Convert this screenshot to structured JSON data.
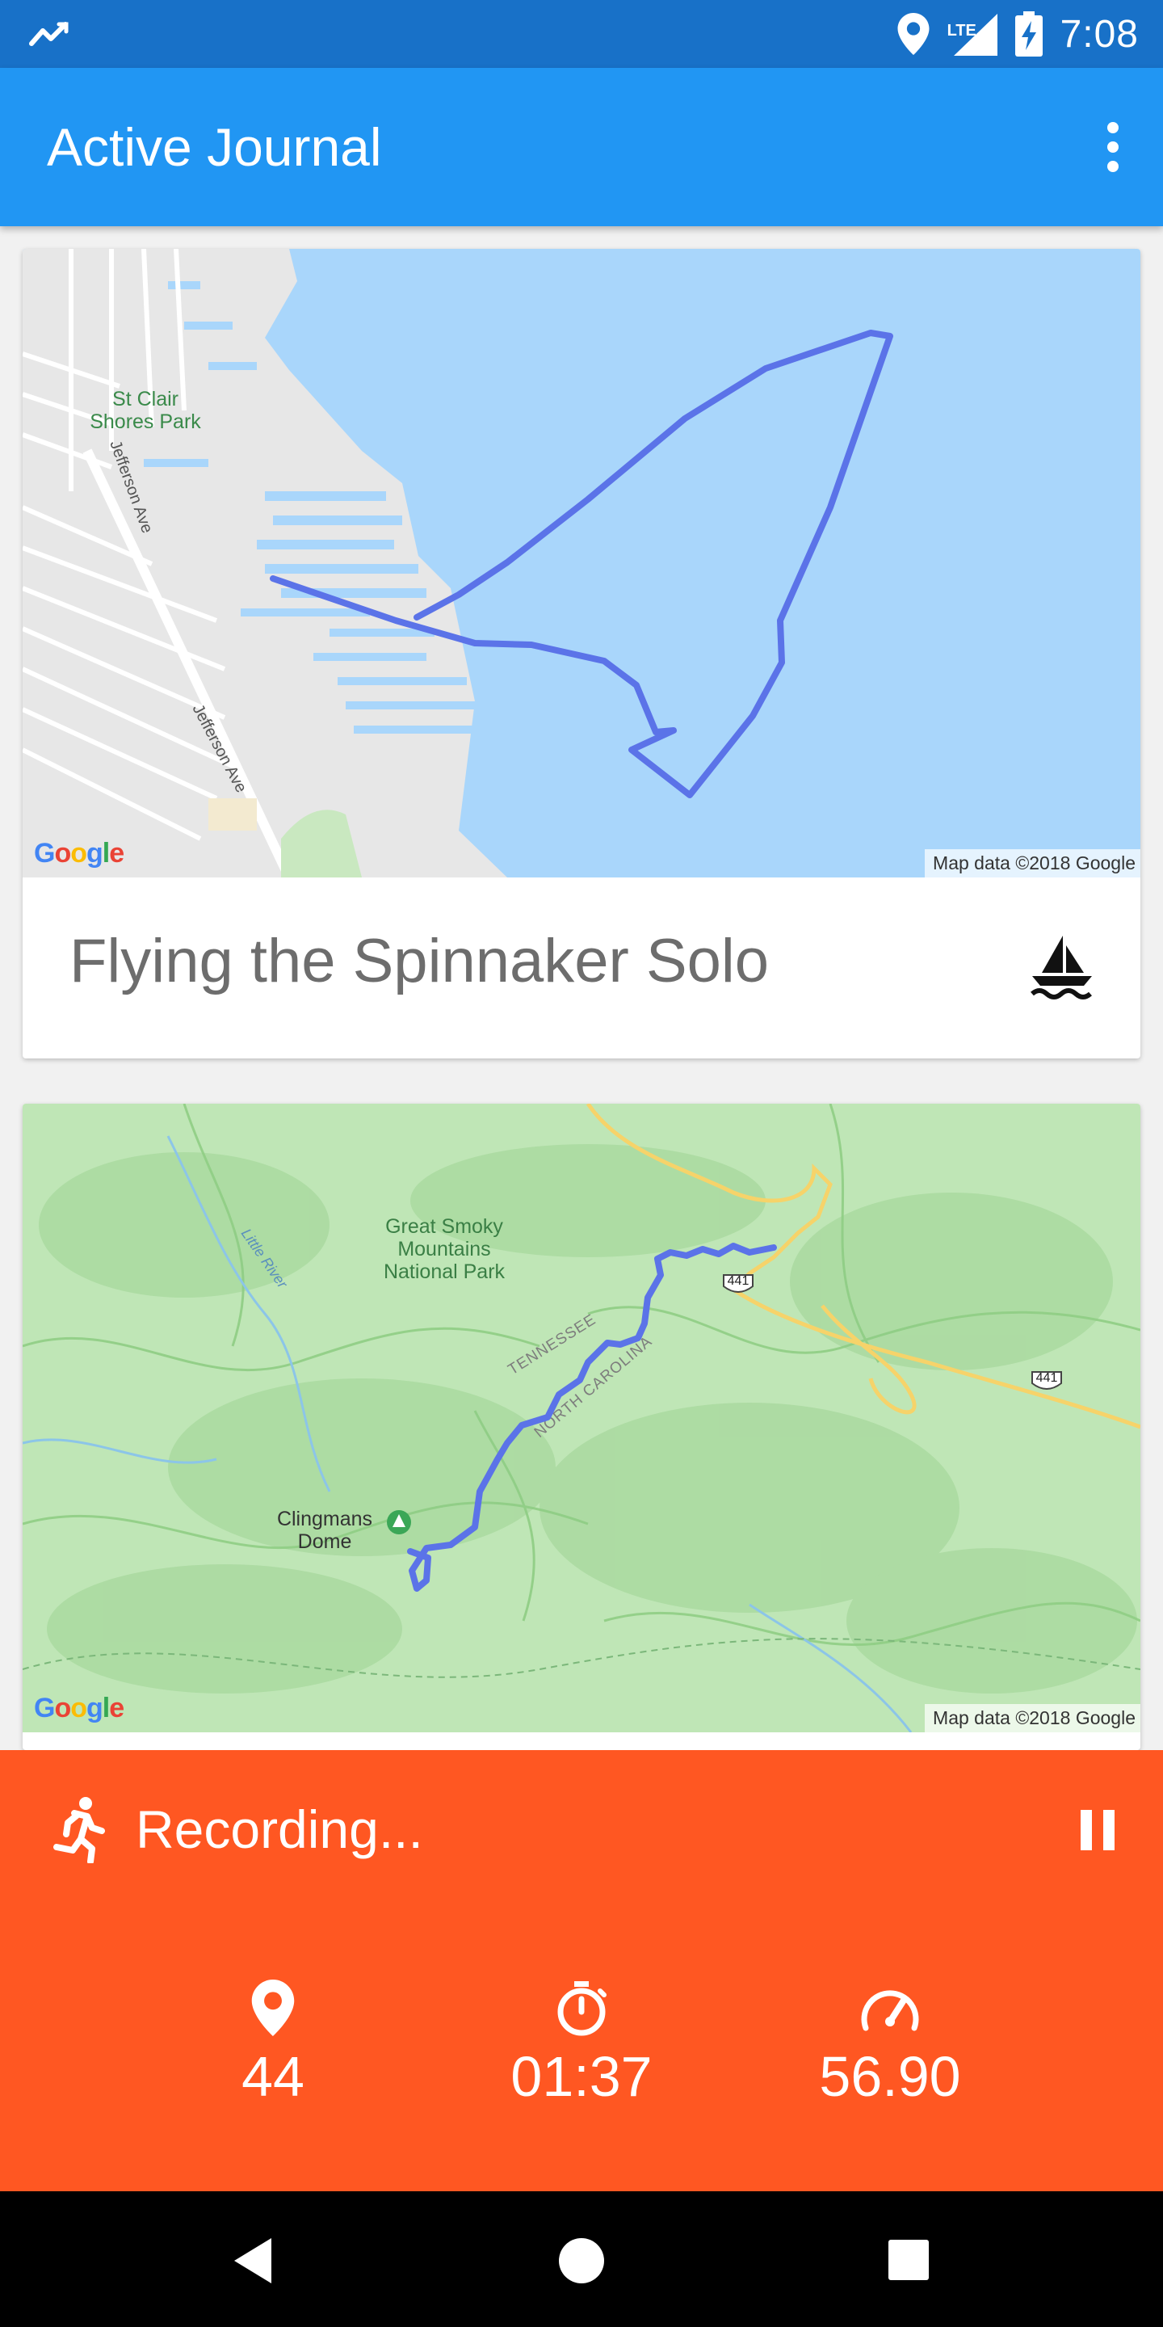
{
  "status_bar": {
    "time": "7:08",
    "network": "LTE",
    "icons": [
      "activity-icon",
      "location-icon",
      "signal-icon",
      "battery-charging-icon"
    ]
  },
  "app_bar": {
    "title": "Active Journal",
    "menu_icon": "more-vert-icon"
  },
  "entries": [
    {
      "title": "Flying the Spinnaker Solo",
      "activity_icon": "sailboat-icon",
      "map": {
        "labels": [
          "St Clair",
          "Shores Park",
          "Jefferson Ave",
          "Jefferson Ave"
        ],
        "attribution": "Map data ©2018 Google",
        "logo": "Google"
      }
    },
    {
      "title": "",
      "activity_icon": "",
      "map": {
        "labels": [
          "Great Smoky",
          "Mountains",
          "National Park",
          "TENNESSEE",
          "NORTH CAROLINA",
          "Clingmans",
          "Dome",
          "Little River",
          "441",
          "441"
        ],
        "attribution": "Map data ©2018 Google",
        "logo": "Google"
      }
    }
  ],
  "recording": {
    "label": "Recording...",
    "activity_icon": "running-icon",
    "control_icon": "pause-icon",
    "stats": [
      {
        "icon": "location-pin-icon",
        "value": "44"
      },
      {
        "icon": "timer-icon",
        "value": "01:37"
      },
      {
        "icon": "speedometer-icon",
        "value": "56.90"
      }
    ]
  },
  "nav_bar": {
    "buttons": [
      "back-button",
      "home-button",
      "recents-button"
    ]
  },
  "colors": {
    "status_bar": "#1871c8",
    "app_bar": "#2196f3",
    "recording_bar": "#ff5722",
    "route": "#5b73e8"
  }
}
